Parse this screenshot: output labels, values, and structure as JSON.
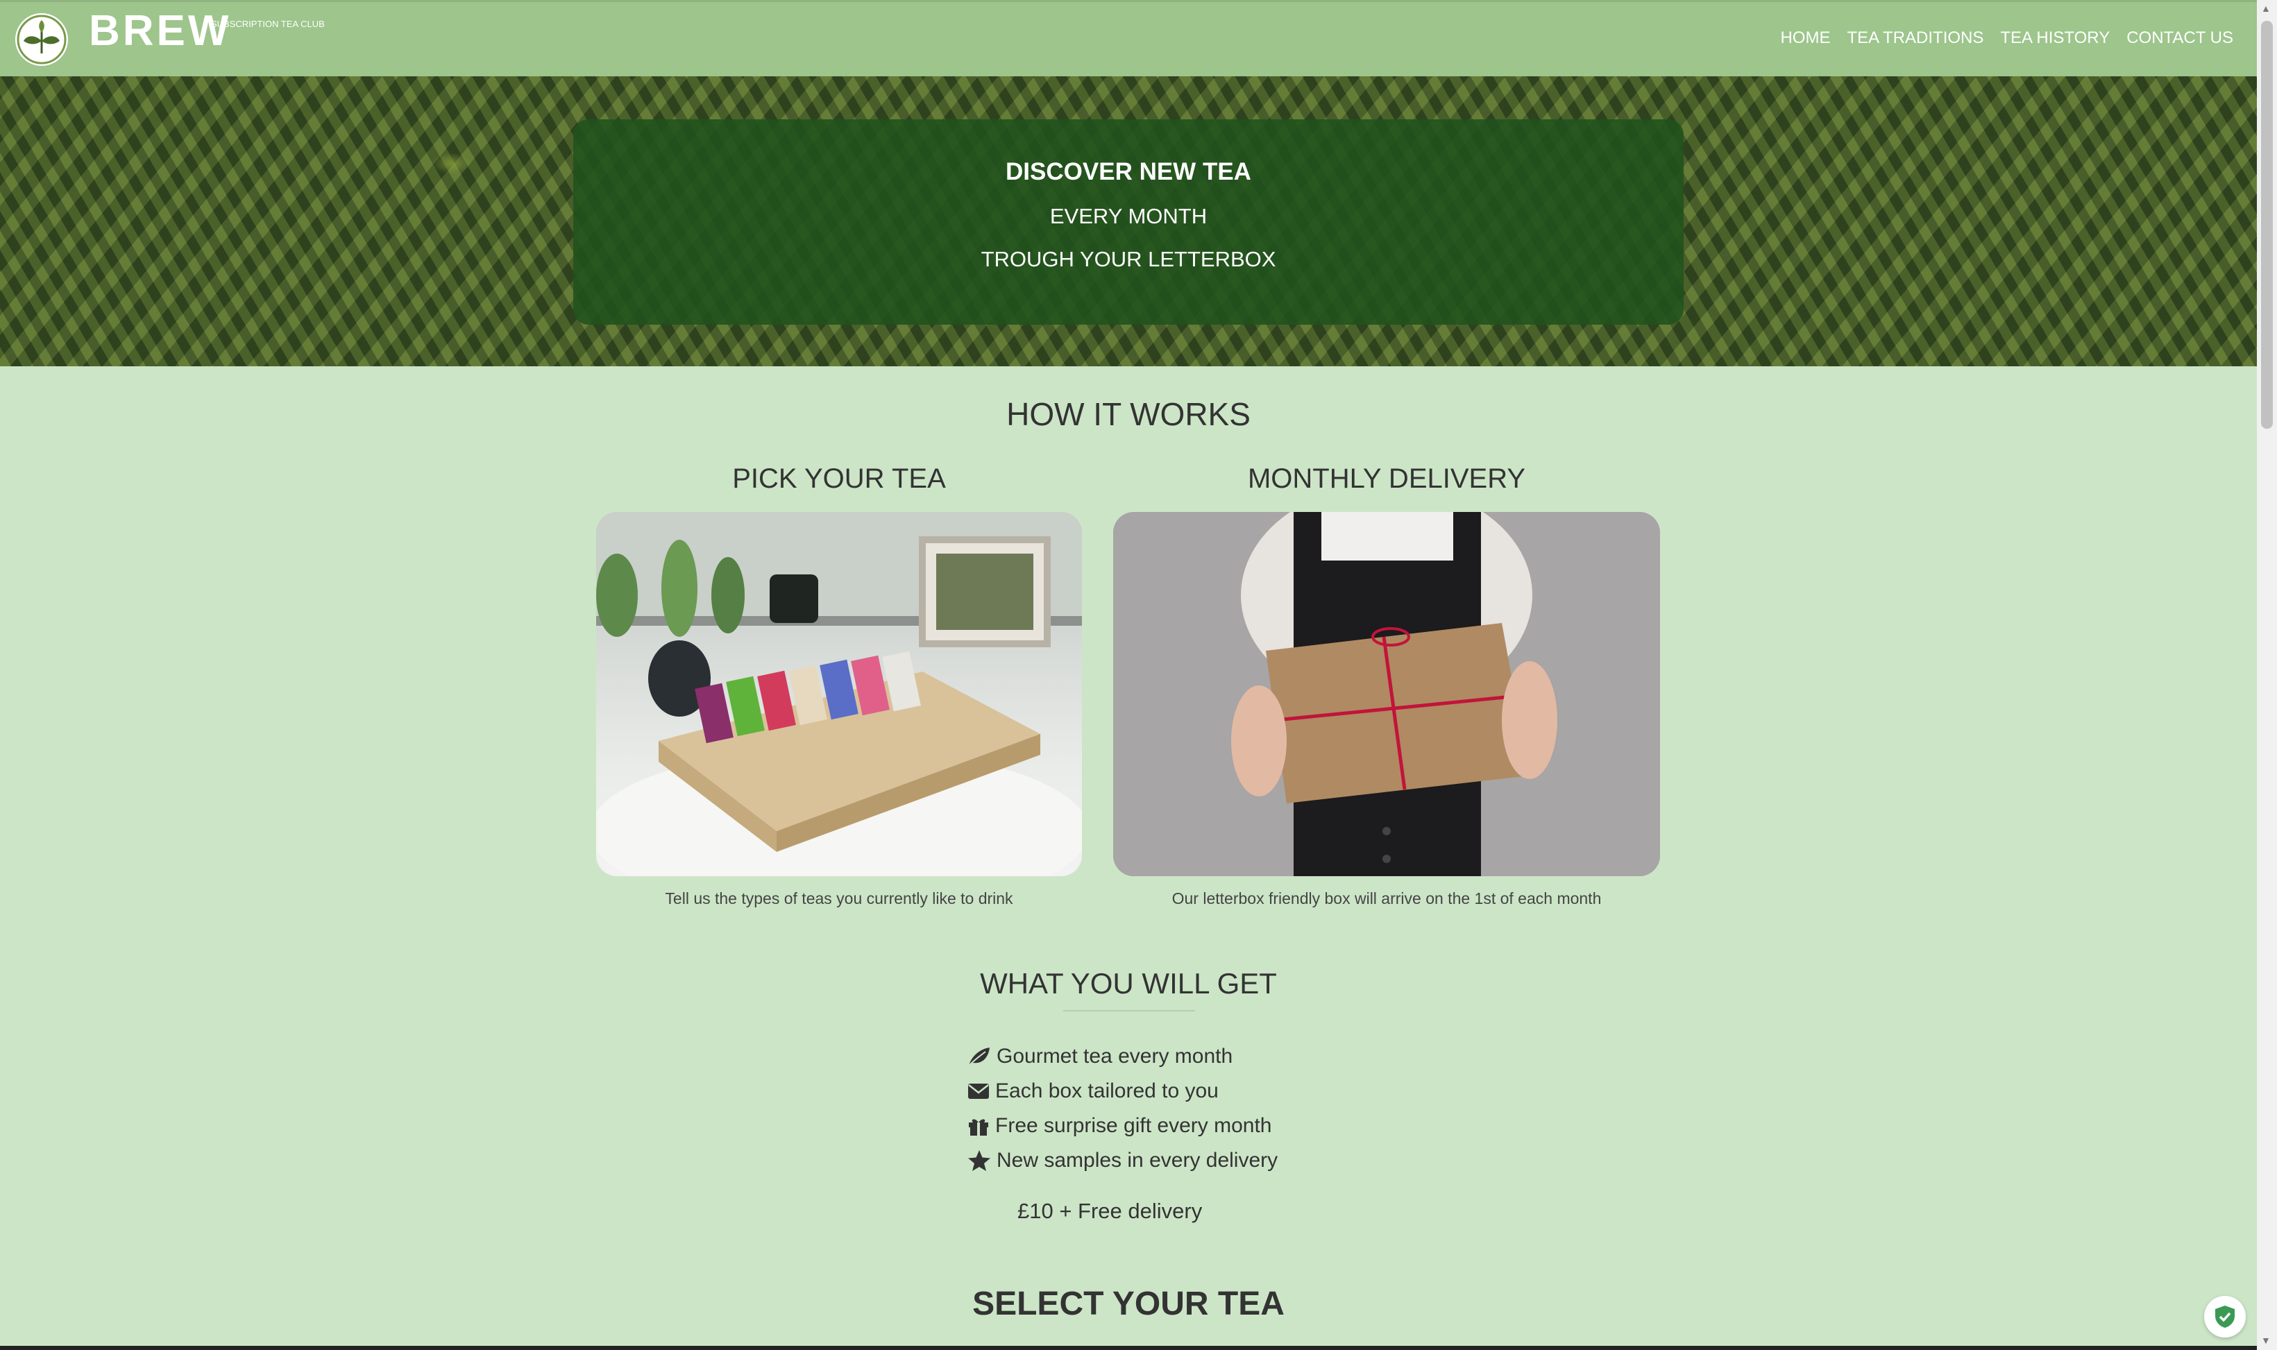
{
  "brand": {
    "name": "BREW",
    "tagline": "SUBSCRIPTION TEA CLUB",
    "logo_icon": "tea-leaf-logo"
  },
  "nav": {
    "items": [
      "HOME",
      "TEA TRADITIONS",
      "TEA HISTORY",
      "CONTACT US"
    ]
  },
  "hero": {
    "line1": "DISCOVER NEW TEA",
    "line2": "EVERY MONTH",
    "line3": "TROUGH YOUR LETTERBOX"
  },
  "how_it_works": {
    "title": "HOW IT WORKS",
    "steps": [
      {
        "title": "PICK YOUR TEA",
        "caption": "Tell us the types of teas you currently like to drink"
      },
      {
        "title": "MONTHLY DELIVERY",
        "caption": "Our letterbox friendly box will arrive on the 1st of each month"
      }
    ]
  },
  "what_you_get": {
    "title": "WHAT YOU WILL GET",
    "benefits": [
      {
        "icon": "leaf-icon",
        "text": "Gourmet tea every month"
      },
      {
        "icon": "envelope-icon",
        "text": "Each box tailored to you"
      },
      {
        "icon": "gift-icon",
        "text": "Free surprise gift every month"
      },
      {
        "icon": "star-icon",
        "text": "New samples in every delivery"
      }
    ],
    "price": "£10 + Free delivery"
  },
  "select": {
    "title": "SELECT YOUR TEA"
  },
  "colors": {
    "navbar": "#9dc58c",
    "page_bg": "#cce5c7",
    "hero_panel": "#20521c",
    "text": "#333333"
  }
}
